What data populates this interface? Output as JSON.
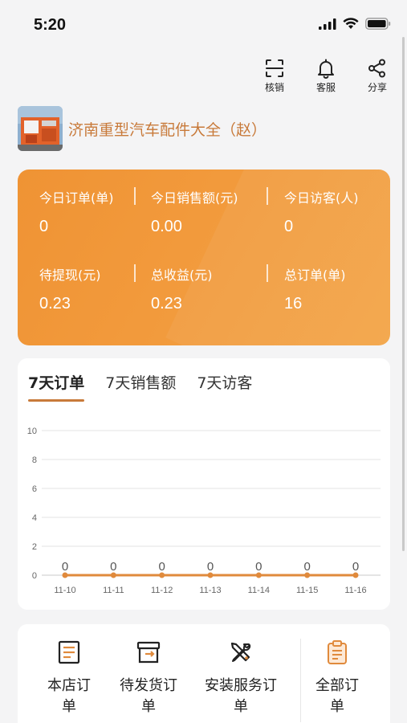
{
  "status_bar": {
    "time": "5:20"
  },
  "top_actions": [
    {
      "label": "核销",
      "icon": "scan-icon"
    },
    {
      "label": "客服",
      "icon": "bell-icon"
    },
    {
      "label": "分享",
      "icon": "share-icon"
    }
  ],
  "shop": {
    "name": "济南重型汽车配件大全（赵）"
  },
  "stats": [
    {
      "label": "今日订单(单)",
      "value": "0"
    },
    {
      "label": "今日销售额(元)",
      "value": "0.00"
    },
    {
      "label": "今日访客(人)",
      "value": "0"
    },
    {
      "label": "待提现(元)",
      "value": "0.23"
    },
    {
      "label": "总收益(元)",
      "value": "0.23"
    },
    {
      "label": "总订单(单)",
      "value": "16"
    }
  ],
  "tabs": [
    {
      "label": "7天订单",
      "active": true
    },
    {
      "label": "7天销售额",
      "active": false
    },
    {
      "label": "7天访客",
      "active": false
    }
  ],
  "chart_data": {
    "type": "line",
    "x": [
      "11-10",
      "11-11",
      "11-12",
      "11-13",
      "11-14",
      "11-15",
      "11-16"
    ],
    "series": [
      {
        "values": [
          0,
          0,
          0,
          0,
          0,
          0,
          0
        ]
      }
    ],
    "ylim": [
      0,
      10
    ],
    "yticks": [
      "0",
      "2",
      "4",
      "6",
      "8",
      "10"
    ],
    "grid": true,
    "color": "#e08a3c",
    "data_labels": [
      "0",
      "0",
      "0",
      "0",
      "0",
      "0",
      "0"
    ]
  },
  "menu": [
    {
      "label": "本店订单",
      "icon": "store-order-icon"
    },
    {
      "label": "待发货订单",
      "icon": "pending-shipment-icon"
    },
    {
      "label": "安装服务订单",
      "icon": "tools-icon"
    },
    {
      "label": "全部订单",
      "icon": "clipboard-icon"
    }
  ],
  "colors": {
    "accent": "#f29a3c",
    "shop_name": "#c87a3a",
    "line": "#e08a3c"
  }
}
